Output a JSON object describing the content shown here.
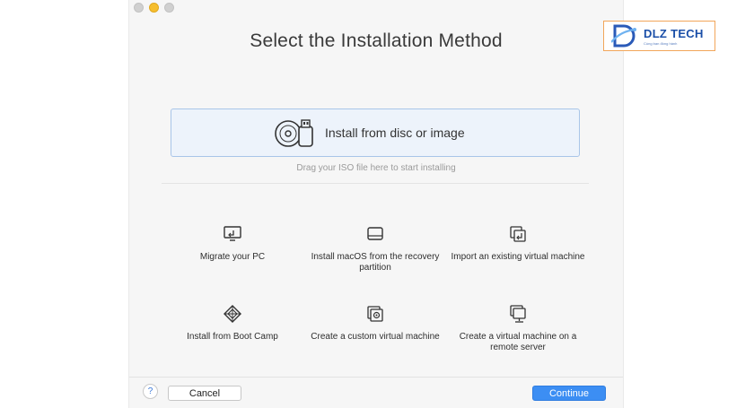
{
  "window": {
    "title": "Select the Installation Method"
  },
  "disc": {
    "label": "Install from disc or image",
    "hint": "Drag your ISO file here to start installing"
  },
  "options": [
    {
      "label": "Migrate your PC",
      "icon": "monitor-arrow-icon"
    },
    {
      "label": "Install macOS from the recovery partition",
      "icon": "drive-icon"
    },
    {
      "label": "Import an existing virtual machine",
      "icon": "import-vm-icon"
    },
    {
      "label": "Install from Boot Camp",
      "icon": "bootcamp-diamond-icon"
    },
    {
      "label": "Create a custom virtual machine",
      "icon": "custom-vm-icon"
    },
    {
      "label": "Create a virtual machine on a remote server",
      "icon": "remote-server-icon"
    }
  ],
  "footer": {
    "help": "?",
    "cancel": "Cancel",
    "continue": "Continue"
  },
  "watermark": {
    "text": "DLZ TECH",
    "tagline": "Cùng bạn đồng hành"
  },
  "colors": {
    "accent": "#3c8ef3",
    "disc_box_bg": "#edf3fb",
    "disc_box_border": "#a9c5e8",
    "window_bg": "#f6f6f6"
  }
}
